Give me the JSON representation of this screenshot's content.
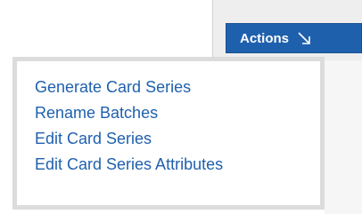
{
  "toolbar": {
    "actions_label": "Actions",
    "actions_icon": "arrow-down-right-icon"
  },
  "menu": {
    "items": [
      {
        "label": "Generate Card Series"
      },
      {
        "label": "Rename Batches"
      },
      {
        "label": "Edit Card Series"
      },
      {
        "label": "Edit Card Series Attributes"
      }
    ]
  },
  "colors": {
    "accent": "#1f60ad",
    "menu_border": "#dcdcdc",
    "toolbar_bg": "#eeeeee"
  }
}
